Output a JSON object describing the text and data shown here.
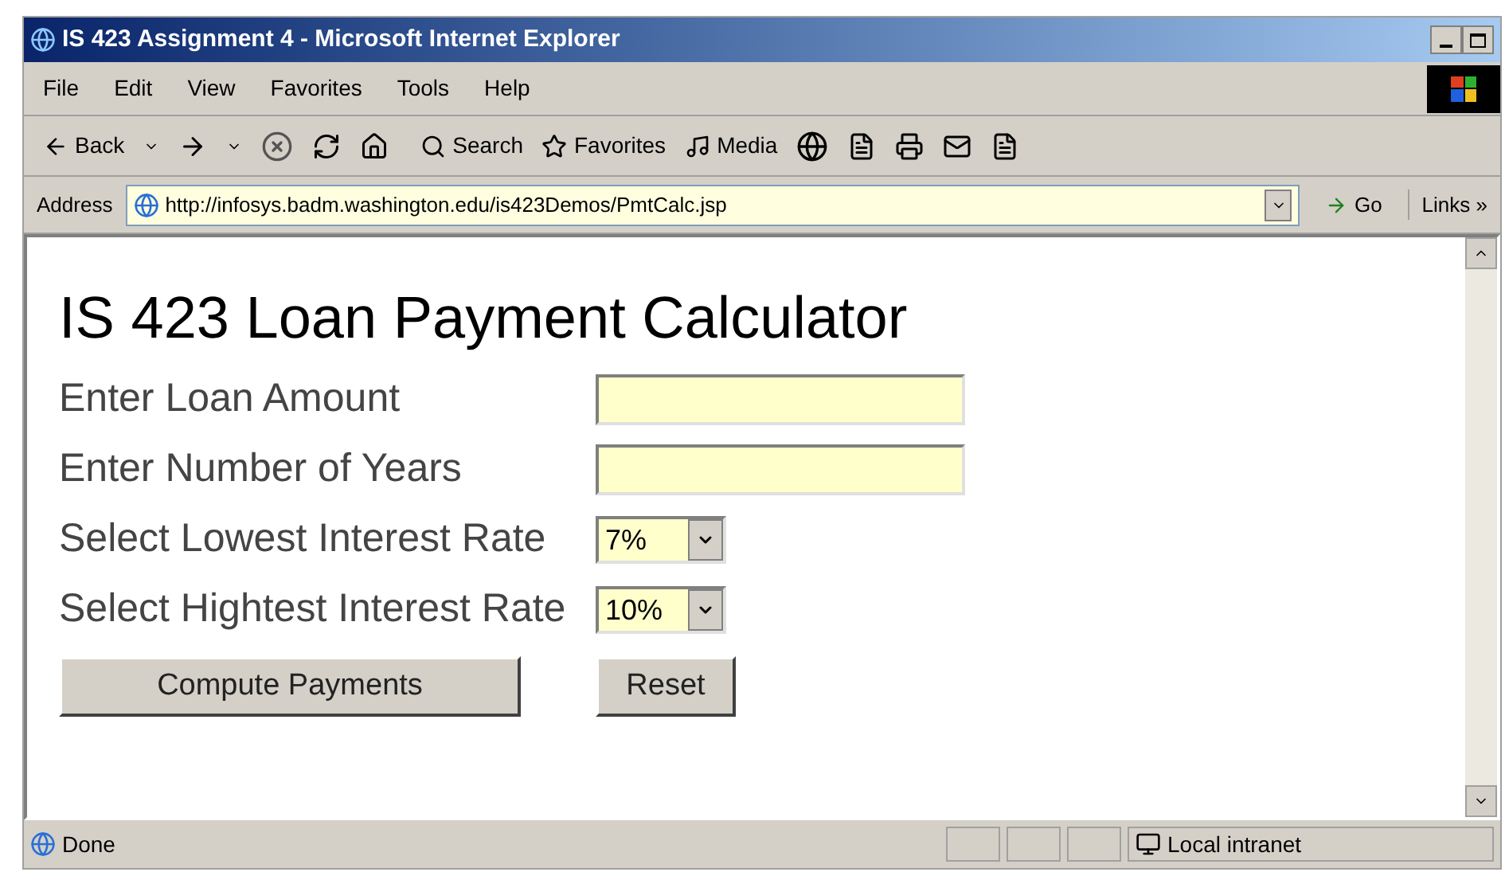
{
  "window": {
    "title": "IS 423 Assignment 4 - Microsoft Internet Explorer"
  },
  "menu": [
    "File",
    "Edit",
    "View",
    "Favorites",
    "Tools",
    "Help"
  ],
  "toolbar": {
    "back": "Back",
    "search": "Search",
    "favorites": "Favorites",
    "media": "Media"
  },
  "address_bar": {
    "label": "Address",
    "url": "http://infosys.badm.washington.edu/is423Demos/PmtCalc.jsp",
    "go": "Go",
    "links": "Links »"
  },
  "page": {
    "heading": "IS 423 Loan Payment Calculator",
    "fields": [
      {
        "kind": "text",
        "label": "Enter Loan Amount"
      },
      {
        "kind": "text",
        "label": "Enter Number of Years"
      },
      {
        "kind": "select",
        "label": "Select Lowest Interest Rate",
        "value": "7%"
      },
      {
        "kind": "select",
        "label": "Select Hightest Interest Rate",
        "value": "10%"
      }
    ],
    "buttons": [
      "Compute Payments",
      "Reset"
    ]
  },
  "status_bar": {
    "text": "Done",
    "zone": "Local intranet"
  }
}
